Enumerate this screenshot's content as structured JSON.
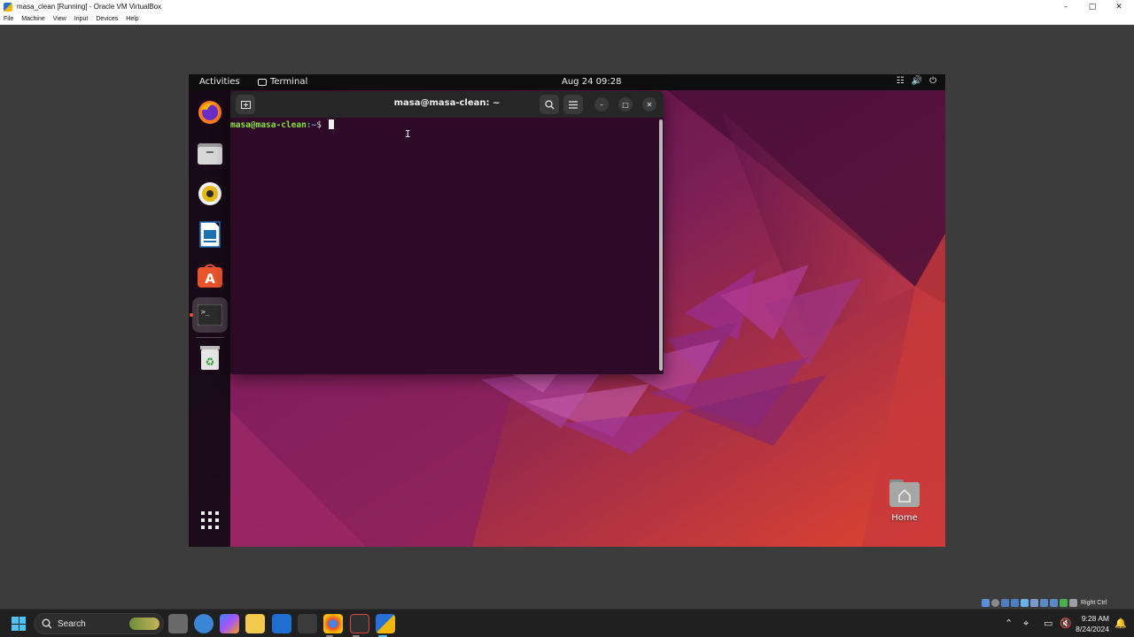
{
  "host": {
    "window_title": "masa_clean [Running] - Oracle VM VirtualBox",
    "menu": [
      "File",
      "Machine",
      "View",
      "Input",
      "Devices",
      "Help"
    ],
    "status_hostkey": "Right Ctrl"
  },
  "guest": {
    "topbar": {
      "activities": "Activities",
      "app_name": "Terminal",
      "clock": "Aug 24  09:28"
    },
    "dock": {
      "items": [
        {
          "name": "firefox",
          "icon": "firefox-icon"
        },
        {
          "name": "files",
          "icon": "files-icon"
        },
        {
          "name": "rhythmbox",
          "icon": "rhythmbox-icon"
        },
        {
          "name": "libreoffice-writer",
          "icon": "writer-icon"
        },
        {
          "name": "ubuntu-software",
          "icon": "software-icon"
        },
        {
          "name": "terminal",
          "icon": "terminal-icon",
          "active": true
        },
        {
          "name": "trash",
          "icon": "trash-icon"
        }
      ],
      "show_apps_icon": "grid-icon"
    },
    "terminal": {
      "title": "masa@masa-clean: ~",
      "prompt_user": "masa@masa-clean",
      "prompt_path": ":~",
      "prompt_symbol": "$ "
    },
    "desktop": {
      "home_label": "Home"
    }
  },
  "taskbar": {
    "search_label": "Search",
    "time": "9:28 AM",
    "date": "8/24/2024"
  },
  "colors": {
    "terminal_bg": "#2c0a28",
    "prompt_user": "#8ae234",
    "prompt_path": "#729fcf",
    "accent": "#e9542c"
  }
}
